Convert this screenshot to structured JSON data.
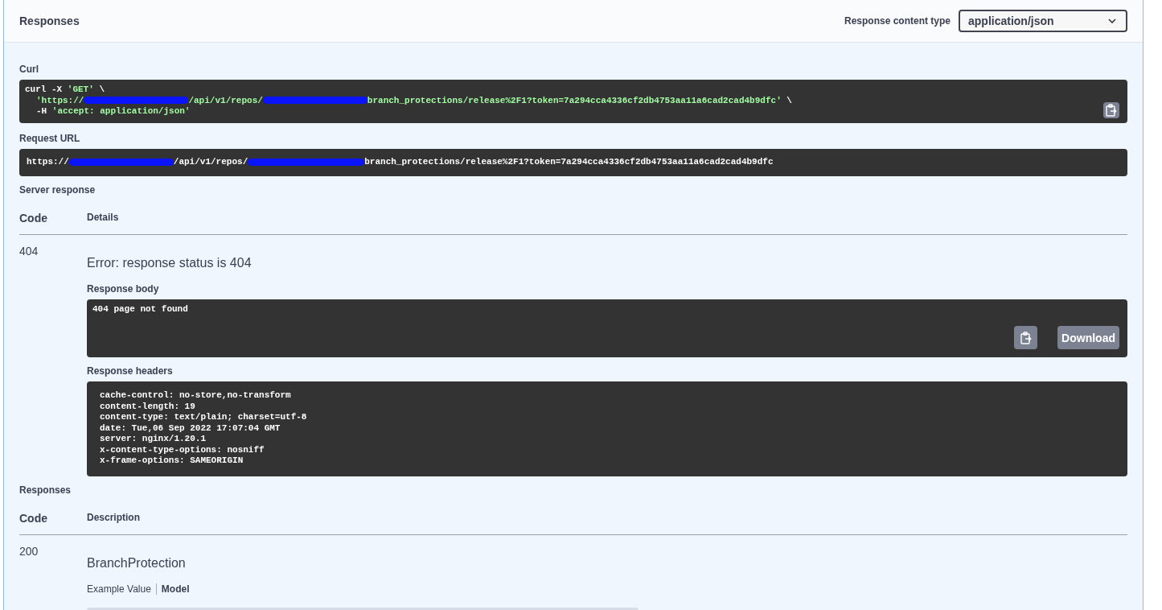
{
  "header": {
    "title": "Responses",
    "content_type_label": "Response content type",
    "content_type": "application/json"
  },
  "curl": {
    "label": "Curl",
    "lines": [
      [
        {
          "kind": "plain",
          "text": "curl -X "
        },
        {
          "kind": "string",
          "text": "'GET'"
        },
        {
          "kind": "plain",
          "text": " \\"
        }
      ],
      [
        {
          "kind": "string",
          "text": "'https://"
        },
        {
          "kind": "redacted"
        },
        {
          "kind": "string",
          "text": "/api/v1/repos/"
        },
        {
          "kind": "redacted"
        },
        {
          "kind": "string",
          "text": "branch_protections/release%2F1?token=7a294cca4336cf2db4753aa11a6cad2cad4b9dfc'"
        },
        {
          "kind": "plain",
          "text": " \\"
        }
      ],
      [
        {
          "kind": "plain",
          "text": "-H "
        },
        {
          "kind": "string",
          "text": "'accept: application/json'"
        }
      ]
    ]
  },
  "request_url": {
    "label": "Request URL",
    "parts": [
      {
        "kind": "plain",
        "text": "https://"
      },
      {
        "kind": "redacted"
      },
      {
        "kind": "plain",
        "text": "/api/v1/repos/"
      },
      {
        "kind": "redacted"
      },
      {
        "kind": "plain",
        "text": "branch_protections/release%2F1?token=7a294cca4336cf2db4753aa11a6cad2cad4b9dfc"
      }
    ]
  },
  "server_response": {
    "label": "Server response",
    "columns": [
      "Code",
      "Details"
    ],
    "code": "404",
    "error": "Error: response status is 404",
    "body_label": "Response body",
    "body": "404 page not found",
    "download": "Download",
    "headers_label": "Response headers",
    "headers": [
      "cache-control: no-store,no-transform",
      "content-length: 19",
      "content-type: text/plain; charset=utf-8",
      "date: Tue,06 Sep 2022 17:07:04 GMT",
      "server: nginx/1.20.1",
      "x-content-type-options: nosniff",
      "x-frame-options: SAMEORIGIN"
    ]
  },
  "responses": {
    "label": "Responses",
    "columns": [
      "Code",
      "Description"
    ],
    "code": "200",
    "description": "BranchProtection",
    "tabs": [
      {
        "label": "Example Value",
        "selected": false
      },
      {
        "label": "Model",
        "selected": true
      }
    ]
  }
}
